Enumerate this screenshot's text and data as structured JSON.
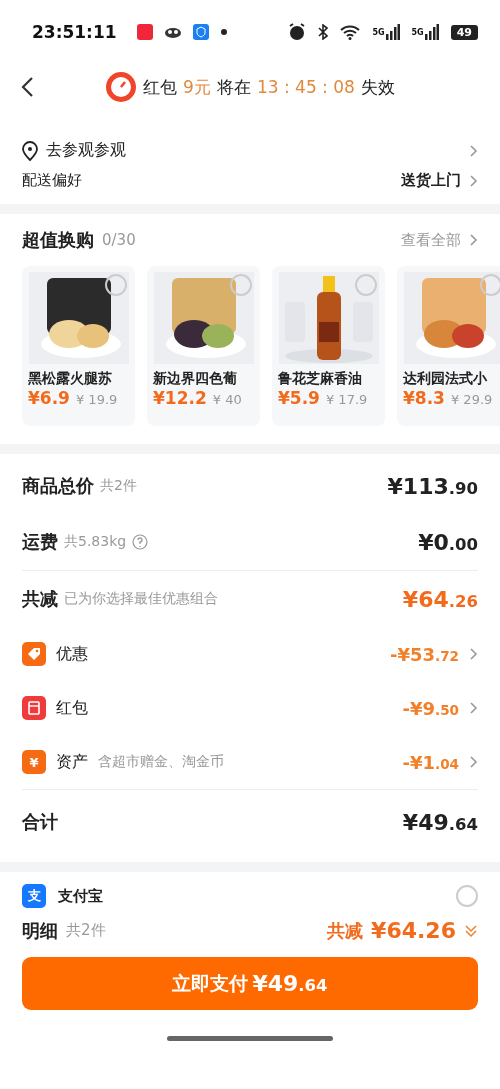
{
  "status_bar": {
    "time": "23:51:11",
    "network_labels": [
      "5G",
      "5G"
    ],
    "battery": "49"
  },
  "header": {
    "label": "红包",
    "amount": "9元",
    "middle": "将在",
    "countdown": "13 : 45 : 08",
    "suffix": "失效"
  },
  "address": {
    "location": "去参观参观",
    "delivery_label": "配送偏好",
    "delivery_value": "送货上门"
  },
  "exchange": {
    "title": "超值换购",
    "count": "0/30",
    "view_all": "查看全部",
    "items": [
      {
        "name": "黑松露火腿苏",
        "price": "¥6.9",
        "original": "¥ 19.9",
        "selected": false
      },
      {
        "name": "新边界四色葡",
        "price": "¥12.2",
        "original": "¥ 40",
        "selected": false
      },
      {
        "name": "鲁花芝麻香油",
        "price": "¥5.9",
        "original": "¥ 17.9",
        "selected": false
      },
      {
        "name": "达利园法式小",
        "price": "¥8.3",
        "original": "¥ 29.9",
        "selected": false
      }
    ]
  },
  "summary": {
    "rows": [
      {
        "kind": "plain",
        "label": "商品总价",
        "note": "共2件",
        "amount": "¥113.90"
      },
      {
        "kind": "weight",
        "label": "运费",
        "note": "共5.83kg",
        "amount": "¥0.00"
      },
      {
        "kind": "discount",
        "label": "共减",
        "note": "已为你选择最佳优惠组合",
        "amount": "¥64.26"
      }
    ],
    "discounts": [
      {
        "kind": "coupon",
        "label": "优惠",
        "amount": "-¥53.72"
      },
      {
        "kind": "redpacket",
        "label": "红包",
        "amount": "-¥9.50"
      },
      {
        "kind": "asset",
        "icon_text": "¥",
        "label": "资产",
        "note": "含超市赠金、淘金币",
        "amount": "-¥1.04"
      }
    ],
    "total_label": "合计",
    "total": "¥49.64"
  },
  "payment": {
    "method": "支付宝",
    "icon_text": "支",
    "selected": false
  },
  "bottom": {
    "detail": "明细",
    "count": "共2件",
    "saved_label": "共减",
    "saved": "¥64.26",
    "pay_button": "立即支付",
    "pay_amount": "¥49.64"
  }
}
